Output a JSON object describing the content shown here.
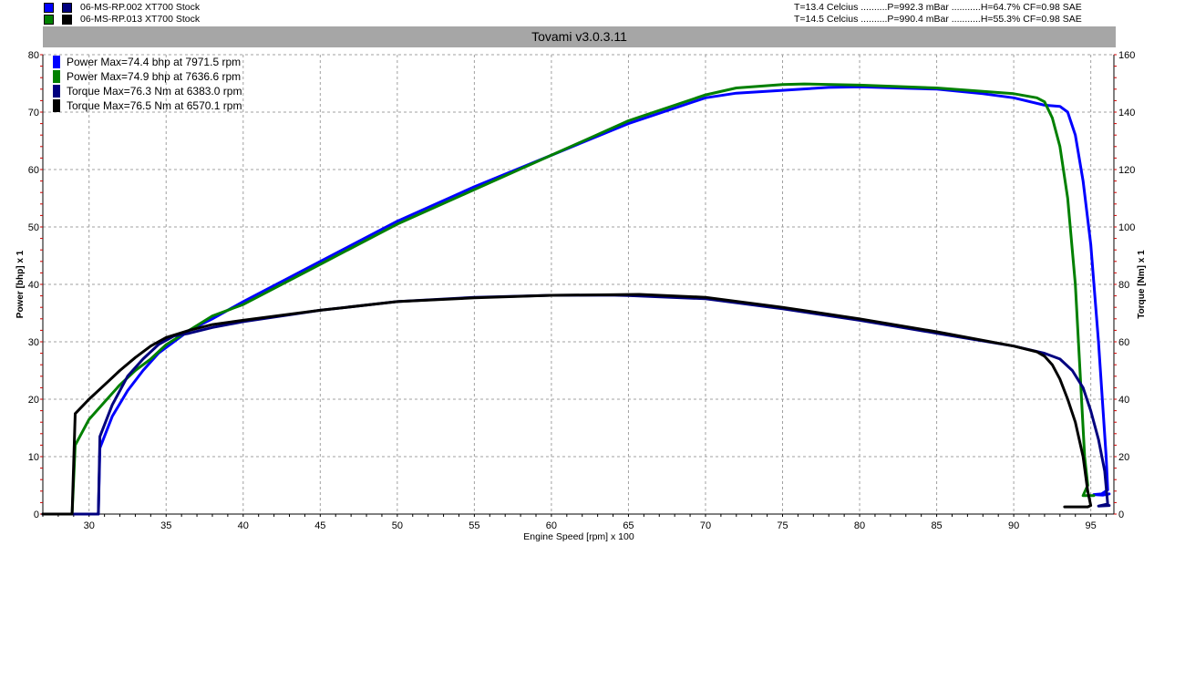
{
  "window": {
    "title": "Tovami  v3.0.3.11"
  },
  "runs": [
    {
      "label": "06-MS-RP.002 XT700   Stock",
      "conditions": "T=13.4 Celcius ..........P=992.3 mBar ...........H=64.7% CF=0.98 SAE",
      "power_color": "#0000ff",
      "torque_color": "#00007f"
    },
    {
      "label": "06-MS-RP.013 XT700   Stock",
      "conditions": "T=14.5 Celcius ..........P=990.4 mBar ...........H=55.3% CF=0.98 SAE",
      "power_color": "#008000",
      "torque_color": "#000000"
    }
  ],
  "chart_data": {
    "type": "line",
    "xlabel": "Engine Speed [rpm] x 100",
    "ylabel_left": "Power [bhp] x 1",
    "ylabel_right": "Torque [Nm] x 1",
    "xlim": [
      27,
      96.5
    ],
    "ylim_left": [
      0,
      80
    ],
    "ylim_right": [
      0,
      160
    ],
    "x_ticks": [
      30,
      35,
      40,
      45,
      50,
      55,
      60,
      65,
      70,
      75,
      80,
      85,
      90,
      95
    ],
    "y_left_ticks": [
      0,
      10,
      20,
      30,
      40,
      50,
      60,
      70,
      80
    ],
    "y_right_ticks": [
      0,
      20,
      40,
      60,
      80,
      100,
      120,
      140,
      160
    ],
    "grid": true,
    "legend_position": "top-left",
    "series": [
      {
        "name": "Power  Max=74.4 bhp at 7971.5 rpm",
        "axis": "left",
        "color": "#0000ff",
        "points": [
          [
            27,
            0
          ],
          [
            30.6,
            0
          ],
          [
            30.7,
            11.5
          ],
          [
            31.5,
            17
          ],
          [
            32.5,
            21.5
          ],
          [
            33.5,
            25
          ],
          [
            34.5,
            28
          ],
          [
            35.5,
            30
          ],
          [
            36.5,
            32
          ],
          [
            38,
            34
          ],
          [
            40,
            37
          ],
          [
            45,
            44
          ],
          [
            50,
            51
          ],
          [
            55,
            57
          ],
          [
            60,
            62.5
          ],
          [
            65,
            68
          ],
          [
            70,
            72.5
          ],
          [
            72,
            73.3
          ],
          [
            75,
            73.8
          ],
          [
            78,
            74.3
          ],
          [
            80,
            74.4
          ],
          [
            85,
            74
          ],
          [
            88,
            73.2
          ],
          [
            90,
            72.5
          ],
          [
            92,
            71.2
          ],
          [
            93,
            71
          ],
          [
            93.5,
            70
          ],
          [
            94,
            66
          ],
          [
            94.5,
            58
          ],
          [
            95,
            47
          ],
          [
            95.5,
            30
          ],
          [
            96,
            10
          ],
          [
            96.1,
            4.2
          ],
          [
            95.7,
            3.5
          ],
          [
            95.2,
            3.4
          ],
          [
            95.8,
            3.3
          ],
          [
            96.2,
            3.5
          ]
        ]
      },
      {
        "name": "Power  Max=74.9 bhp at 7636.6 rpm",
        "axis": "left",
        "color": "#008000",
        "points": [
          [
            27,
            0
          ],
          [
            28.9,
            0
          ],
          [
            29.1,
            12
          ],
          [
            30,
            16.5
          ],
          [
            31,
            19.5
          ],
          [
            32,
            22.5
          ],
          [
            33,
            25
          ],
          [
            34,
            27
          ],
          [
            35,
            29.5
          ],
          [
            36.5,
            32
          ],
          [
            38,
            34.5
          ],
          [
            40,
            36.5
          ],
          [
            45,
            43.5
          ],
          [
            50,
            50.5
          ],
          [
            55,
            56.5
          ],
          [
            60,
            62.5
          ],
          [
            65,
            68.5
          ],
          [
            70,
            73
          ],
          [
            72,
            74.2
          ],
          [
            75,
            74.8
          ],
          [
            76.4,
            74.9
          ],
          [
            80,
            74.7
          ],
          [
            85,
            74.2
          ],
          [
            90,
            73.2
          ],
          [
            91.5,
            72.5
          ],
          [
            92,
            71.8
          ],
          [
            92.5,
            69
          ],
          [
            93,
            64
          ],
          [
            93.5,
            55
          ],
          [
            94,
            40
          ],
          [
            94.3,
            25
          ],
          [
            94.6,
            10
          ],
          [
            94.8,
            5
          ],
          [
            94.5,
            3.2
          ],
          [
            95.2,
            3.2
          ]
        ]
      },
      {
        "name": "Torque  Max=76.3 Nm at 6383.0 rpm",
        "axis": "right",
        "color": "#00007f",
        "points": [
          [
            27,
            0
          ],
          [
            30.6,
            0
          ],
          [
            30.7,
            27
          ],
          [
            31.5,
            38
          ],
          [
            32.5,
            48
          ],
          [
            33.5,
            54
          ],
          [
            34.5,
            59
          ],
          [
            35.5,
            62
          ],
          [
            36.5,
            63
          ],
          [
            38,
            65
          ],
          [
            40,
            67
          ],
          [
            45,
            71
          ],
          [
            50,
            74
          ],
          [
            55,
            75.5
          ],
          [
            60,
            76.2
          ],
          [
            63.8,
            76.3
          ],
          [
            65,
            76.1
          ],
          [
            70,
            75
          ],
          [
            75,
            71.5
          ],
          [
            80,
            67.5
          ],
          [
            85,
            63
          ],
          [
            90,
            58.5
          ],
          [
            92,
            56
          ],
          [
            93,
            54
          ],
          [
            93.8,
            50
          ],
          [
            94.5,
            44
          ],
          [
            95,
            36
          ],
          [
            95.5,
            26
          ],
          [
            95.9,
            15
          ],
          [
            96.1,
            3.5
          ],
          [
            95.5,
            2.8
          ],
          [
            96.2,
            3
          ]
        ]
      },
      {
        "name": "Torque  Max=76.5 Nm at 6570.1 rpm",
        "axis": "right",
        "color": "#000000",
        "points": [
          [
            27,
            0
          ],
          [
            28.9,
            0
          ],
          [
            29.1,
            35
          ],
          [
            30,
            40
          ],
          [
            31,
            45
          ],
          [
            32,
            50
          ],
          [
            33,
            54.5
          ],
          [
            34,
            58.5
          ],
          [
            35,
            61.5
          ],
          [
            36.5,
            64
          ],
          [
            38,
            66
          ],
          [
            40,
            67.5
          ],
          [
            45,
            71
          ],
          [
            50,
            74
          ],
          [
            55,
            75.3
          ],
          [
            60,
            76.2
          ],
          [
            65.7,
            76.5
          ],
          [
            70,
            75.5
          ],
          [
            75,
            72
          ],
          [
            80,
            68
          ],
          [
            85,
            63.5
          ],
          [
            90,
            58.5
          ],
          [
            91.5,
            56.5
          ],
          [
            92,
            55
          ],
          [
            92.5,
            52
          ],
          [
            93,
            47
          ],
          [
            93.5,
            40
          ],
          [
            94,
            32
          ],
          [
            94.5,
            20
          ],
          [
            94.8,
            8
          ],
          [
            95,
            3
          ],
          [
            94.8,
            2.5
          ],
          [
            93.3,
            2.5
          ]
        ]
      }
    ]
  }
}
